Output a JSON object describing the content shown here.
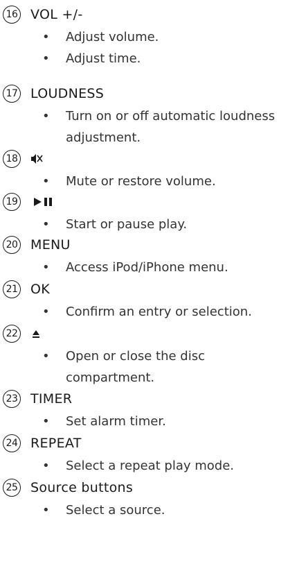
{
  "items": [
    {
      "number": "16",
      "title": "VOL +/-",
      "bullets": [
        "Adjust volume.",
        "Adjust time."
      ]
    },
    {
      "number": "17",
      "title": "LOUDNESS",
      "bullets": [
        "Turn on or off automatic loudness adjustment."
      ]
    },
    {
      "number": "18",
      "icon": "mute-icon",
      "bullets": [
        "Mute or restore volume."
      ]
    },
    {
      "number": "19",
      "icon": "play-pause-icon",
      "bullets": [
        "Start or pause play."
      ]
    },
    {
      "number": "20",
      "title": "MENU",
      "bullets": [
        "Access iPod/iPhone menu."
      ]
    },
    {
      "number": "21",
      "title": "OK",
      "bullets": [
        "Confirm an entry or selection."
      ]
    },
    {
      "number": "22",
      "icon": "eject-icon",
      "bullets": [
        "Open or close the disc compartment."
      ]
    },
    {
      "number": "23",
      "title": "TIMER",
      "bullets": [
        "Set alarm timer."
      ]
    },
    {
      "number": "24",
      "title": "REPEAT",
      "bullets": [
        "Select a repeat play mode."
      ]
    },
    {
      "number": "25",
      "title": "Source buttons",
      "bullets": [
        "Select a source."
      ]
    }
  ]
}
